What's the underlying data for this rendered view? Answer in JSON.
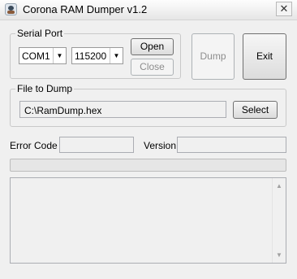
{
  "window": {
    "title": "Corona RAM Dumper v1.2",
    "close_glyph": "✕"
  },
  "serial_port": {
    "legend": "Serial Port",
    "port_value": "COM1",
    "baud_value": "115200",
    "open_label": "Open",
    "close_label": "Close"
  },
  "actions": {
    "dump_label": "Dump",
    "exit_label": "Exit"
  },
  "file_to_dump": {
    "legend": "File to Dump",
    "path_value": "C:\\RamDump.hex",
    "select_label": "Select"
  },
  "info": {
    "error_code_label": "Error Code",
    "error_code_value": "",
    "version_label": "Version",
    "version_value": ""
  },
  "progress": {
    "fraction": 0
  },
  "log": {
    "text": "",
    "scroll_up_glyph": "▲",
    "scroll_down_glyph": "▼"
  }
}
